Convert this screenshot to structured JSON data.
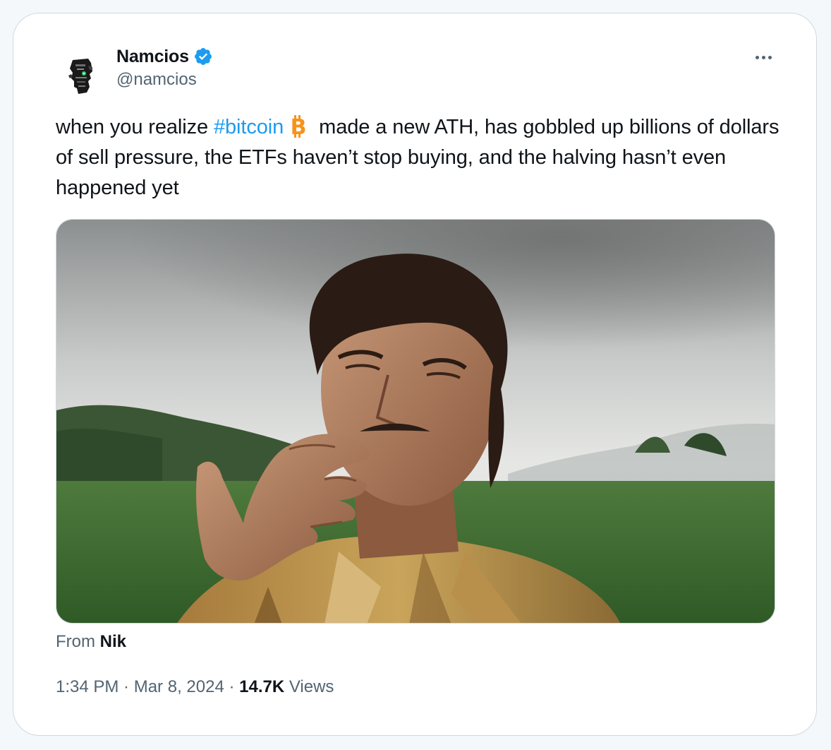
{
  "author": {
    "display_name": "Namcios",
    "handle": "@namcios",
    "verified": true,
    "avatar_icon": "robot-head-avatar-icon"
  },
  "tweet": {
    "text_before": "when you realize ",
    "hashtag": "#bitcoin",
    "emoji_icon": "bitcoin-icon",
    "text_after": "made a new ATH, has gobbled up billions of dollars of sell pressure, the ETFs haven’t stop buying, and the halving hasn’t even happened yet"
  },
  "media": {
    "type": "video-still",
    "description_icon": "media-thumbnail"
  },
  "attribution": {
    "prefix": "From ",
    "source": "Nik"
  },
  "meta": {
    "time": "1:34 PM",
    "separator": " · ",
    "date": "Mar 8, 2024",
    "views_count": "14.7K",
    "views_label": " Views"
  },
  "colors": {
    "link": "#1d9bf0",
    "verified": "#1d9bf0",
    "bitcoin": "#f7931a",
    "secondary_text": "#536471",
    "primary_text": "#0f1419"
  }
}
